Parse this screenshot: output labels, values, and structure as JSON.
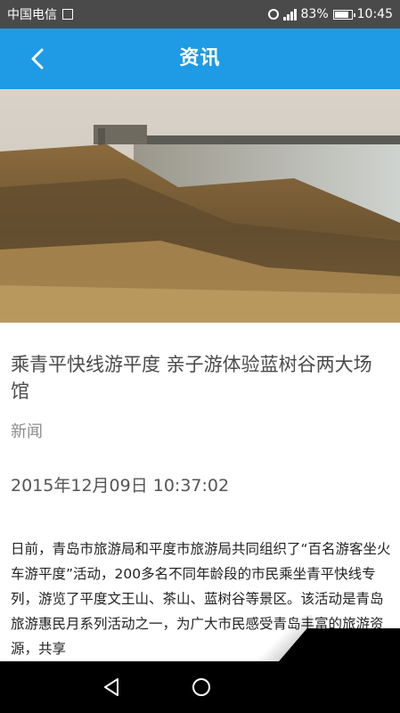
{
  "status_bar": {
    "carrier": "中国电信",
    "battery": "83%",
    "time": "10:45",
    "icons": [
      "sim-icon",
      "alarm-icon",
      "signal-icon",
      "battery-icon"
    ]
  },
  "header": {
    "title": "资讯",
    "back_icon": "chevron-left-icon"
  },
  "article": {
    "title": "乘青平快线游平度 亲子游体验蓝树谷两大场馆",
    "category": "新闻",
    "date": "2015年12月09日 10:37:02",
    "body": "日前，青岛市旅游局和平度市旅游局共同组织了“百名游客坐火车游平度”活动，200多名不同年龄段的市民乘坐青平快线专列，游览了平度文王山、茶山、蓝树谷等景区。该活动是青岛旅游惠民月系列活动之一，为广大市民感受青岛丰富的旅游资源，共享"
  },
  "nav_bar": {
    "icons": [
      "nav-back-icon",
      "nav-home-icon"
    ]
  },
  "colors": {
    "status_bar": "#4a4a4a",
    "app_bar": "#1e9be4",
    "nav_bar": "#000000"
  }
}
